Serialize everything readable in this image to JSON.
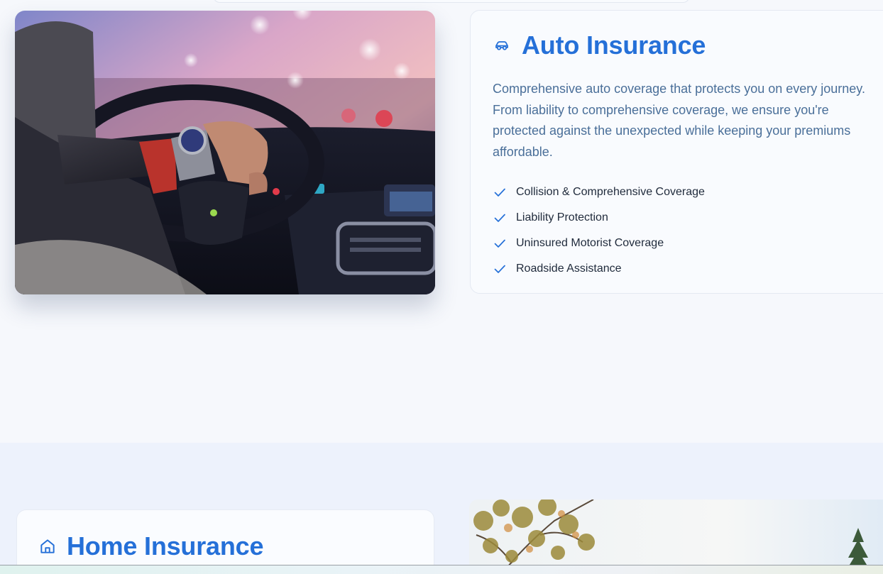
{
  "auto": {
    "icon": "car-icon",
    "title": "Auto Insurance",
    "description": "Comprehensive auto coverage that protects you on every journey. From liability to comprehensive coverage, we ensure you're protected against the unexpected while keeping your premiums affordable.",
    "image_alt": "Driver with hand on steering wheel",
    "features": [
      "Collision & Comprehensive Coverage",
      "Liability Protection",
      "Uninsured Motorist Coverage",
      "Roadside Assistance"
    ]
  },
  "home": {
    "icon": "home-icon",
    "title": "Home Insurance",
    "image_alt": "Trees under a bright sky"
  },
  "colors": {
    "accent": "#2570d8",
    "description": "#4a6f99",
    "background": "#f6f8fc"
  }
}
